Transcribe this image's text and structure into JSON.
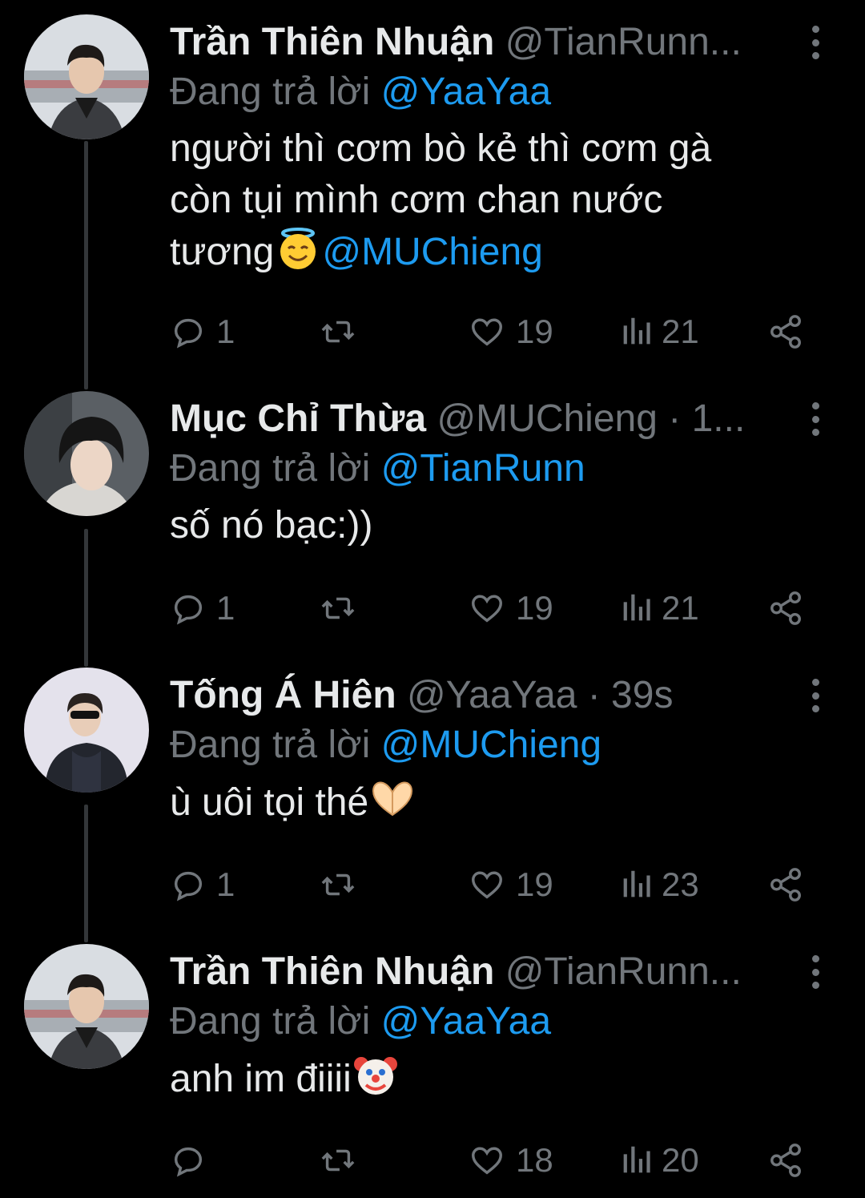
{
  "colors": {
    "background": "#000000",
    "text_primary": "#e7e9ea",
    "text_secondary": "#71767b",
    "accent": "#1d9bf0",
    "thread_line": "#333639"
  },
  "reply_prefix": "Đang trả lời",
  "icons": [
    "reply-icon",
    "retweet-icon",
    "like-icon",
    "views-icon",
    "share-icon",
    "more-icon"
  ],
  "tweets": [
    {
      "name": "Trần Thiên Nhuận",
      "handle": "@TianRunn...",
      "replying_to": "@YaaYaa",
      "text": "người thì cơm bò kẻ thì cơm gà\ncòn tụi mình cơm chan nước\ntương",
      "emoji": "smiling-face-with-halo",
      "mention": "@MUChieng",
      "replies": "1",
      "retweets": "",
      "likes": "19",
      "views": "21"
    },
    {
      "name": "Mục Chỉ Thừa",
      "handle": "@MUChieng · 1...",
      "replying_to": "@TianRunn",
      "text": "số nó bạc:))",
      "replies": "1",
      "retweets": "",
      "likes": "19",
      "views": "21"
    },
    {
      "name": "Tống Á Hiên",
      "handle": "@YaaYaa · 39s",
      "replying_to": "@MUChieng",
      "text": "ù uôi tọi thé",
      "emoji": "heart-hands",
      "replies": "1",
      "retweets": "",
      "likes": "19",
      "views": "23"
    },
    {
      "name": "Trần Thiên Nhuận",
      "handle": "@TianRunn...",
      "replying_to": "@YaaYaa",
      "text": "anh im điiii",
      "emoji": "clown-face",
      "replies": "",
      "retweets": "",
      "likes": "18",
      "views": "20"
    }
  ]
}
